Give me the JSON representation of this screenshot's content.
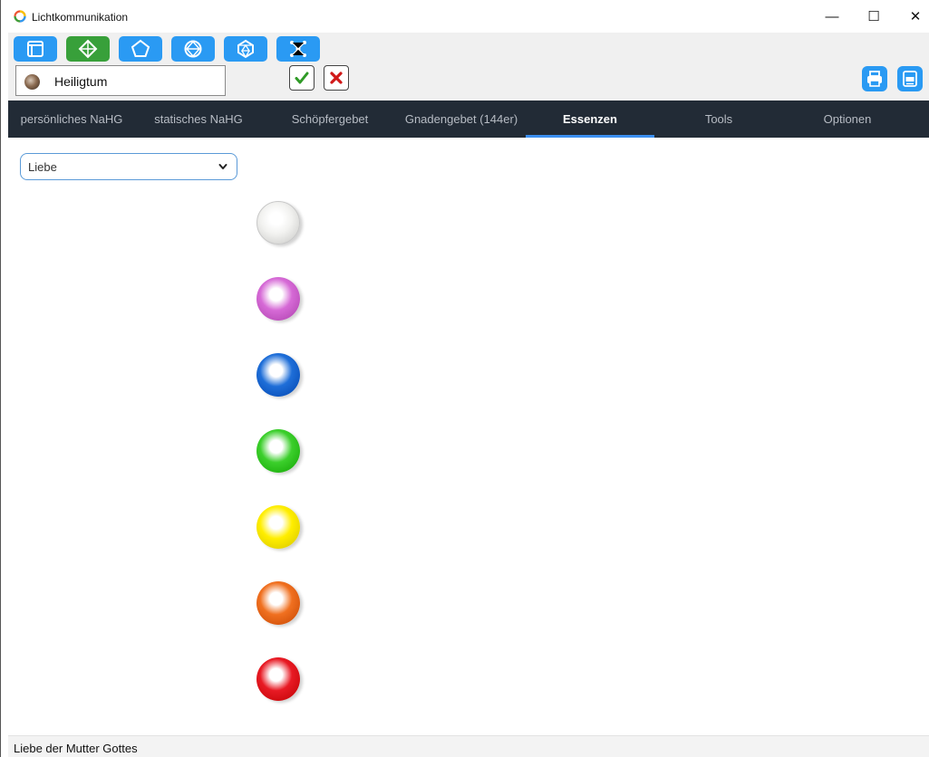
{
  "window": {
    "title": "Lichtkommunikation",
    "controls": {
      "minimize": "—",
      "maximize": "☐",
      "close": "✕"
    }
  },
  "toolbar": {
    "tools": [
      {
        "icon": "window-icon",
        "active": false
      },
      {
        "icon": "diamond-icon",
        "active": true
      },
      {
        "icon": "pentagon-icon",
        "active": false
      },
      {
        "icon": "polyhedron-icon",
        "active": false
      },
      {
        "icon": "icosahedron-icon",
        "active": false
      },
      {
        "icon": "network-icon",
        "active": false
      }
    ],
    "person": {
      "name": "Heiligtum"
    },
    "confirm_icon": "checkmark-icon",
    "cancel_icon": "close-icon",
    "right_icons": [
      "print-icon",
      "print-pdf-icon"
    ]
  },
  "tabs": [
    {
      "label": "persönliches NaHG",
      "active": false
    },
    {
      "label": "statisches NaHG",
      "active": false
    },
    {
      "label": "Schöpfergebet",
      "active": false
    },
    {
      "label": "Gnadengebet (144er)",
      "active": false
    },
    {
      "label": "Essenzen",
      "active": true
    },
    {
      "label": "Tools",
      "active": false
    },
    {
      "label": "Optionen",
      "active": false
    }
  ],
  "content": {
    "essence_select": {
      "value": "Liebe"
    },
    "orbs": [
      {
        "name": "white",
        "color": "#f2f2f0"
      },
      {
        "name": "pink",
        "color": "#d66ad6"
      },
      {
        "name": "blue",
        "color": "#1e6ed8"
      },
      {
        "name": "green",
        "color": "#3ccf2c"
      },
      {
        "name": "yellow",
        "color": "#ffee00"
      },
      {
        "name": "orange",
        "color": "#f07020"
      },
      {
        "name": "red",
        "color": "#e81a24"
      }
    ]
  },
  "status": {
    "text": "Liebe der Mutter Gottes"
  },
  "colors": {
    "accent": "#2a9af3",
    "active_tool": "#38a03a",
    "tabbar_bg": "#222b36",
    "tab_indicator": "#3b8ff0"
  }
}
